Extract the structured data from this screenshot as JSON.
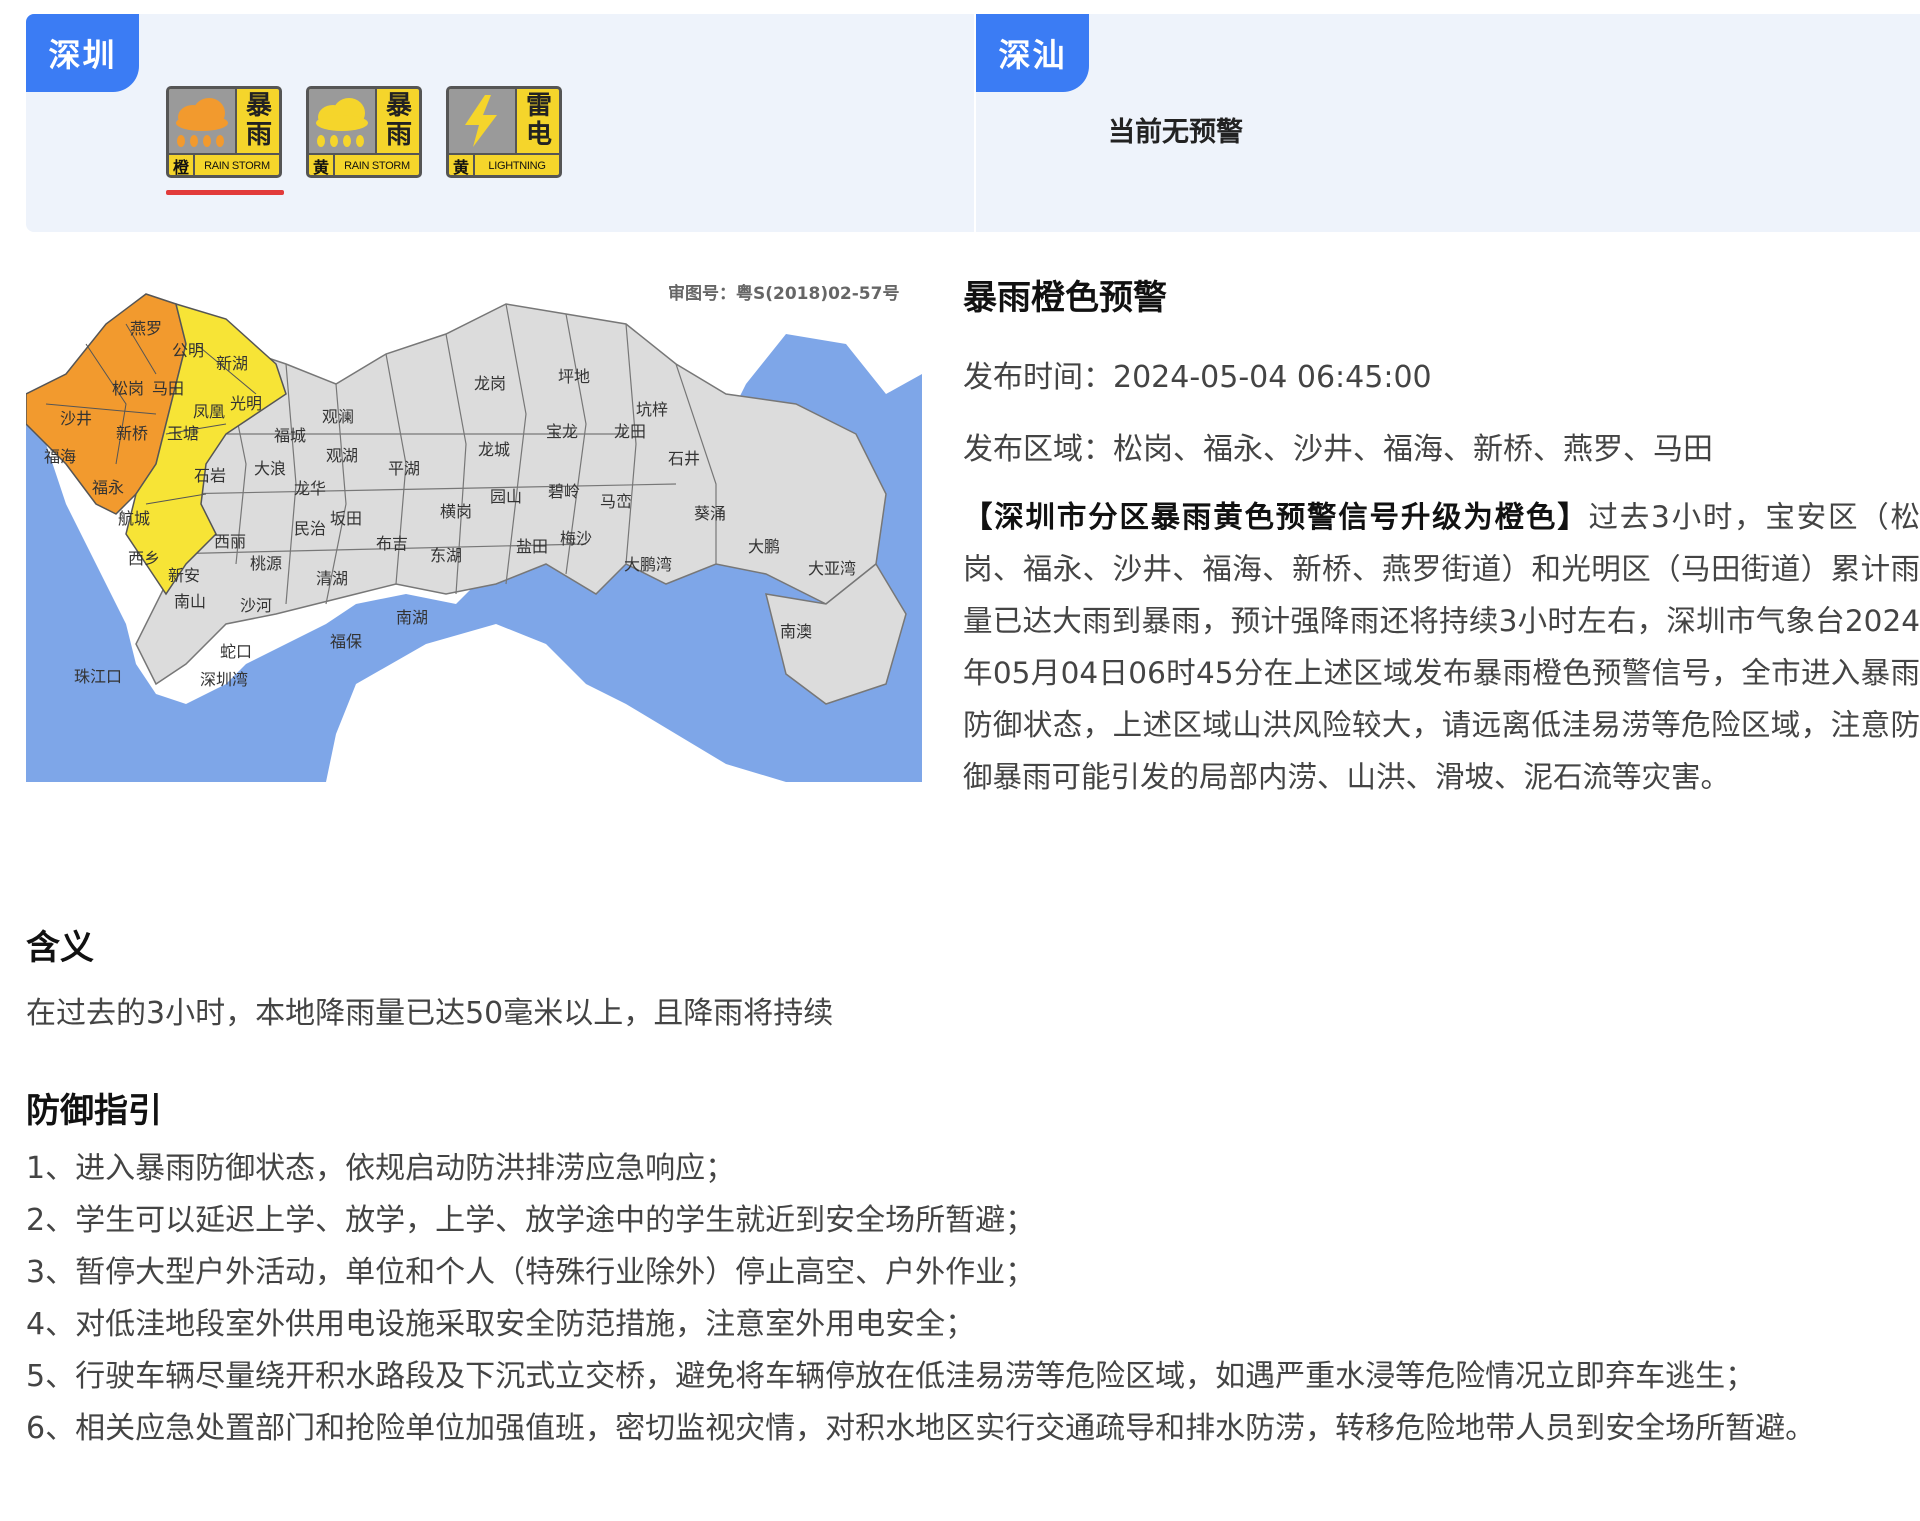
{
  "regions": [
    {
      "name": "深圳"
    },
    {
      "name": "深汕",
      "status_text": "当前无预警"
    }
  ],
  "warnings": [
    {
      "chars": [
        "暴",
        "雨"
      ],
      "level": "橙",
      "en": "RAIN STORM",
      "color": "#f29a2e",
      "icon": "rain-cloud-icon",
      "selected": true
    },
    {
      "chars": [
        "暴",
        "雨"
      ],
      "level": "黄",
      "en": "RAIN STORM",
      "color": "#f5d52b",
      "icon": "rain-cloud-icon",
      "selected": false
    },
    {
      "chars": [
        "雷",
        "电"
      ],
      "level": "黄",
      "en": "LIGHTNING",
      "color": "#f5d52b",
      "icon": "lightning-icon",
      "selected": false
    }
  ],
  "map": {
    "approval_no": "审图号：粤S(2018)02-57号",
    "labels": {
      "yanluo": "燕罗",
      "gongming": "公明",
      "xinhu": "新湖",
      "songgang": "松岗",
      "matian": "马田",
      "shajing": "沙井",
      "fengyuan": "凤凰",
      "guangming": "光明",
      "xinqiao": "新桥",
      "yutang": "玉塘",
      "fuhai": "福海",
      "fuyong": "福永",
      "shiyan": "石岩",
      "hangcheng": "航城",
      "xixiang": "西乡",
      "guanlan": "观澜",
      "guanhu": "观湖",
      "longhua": "龙华",
      "minzhi": "民治",
      "dalang": "大浪",
      "fucheng": "福城",
      "pinghu": "平湖",
      "longgang": "龙岗",
      "pingdi": "坪地",
      "baolong": "宝龙",
      "longcheng": "龙城",
      "yuanshan": "园山",
      "bijling": "碧岭",
      "mawanzhi": "马峦",
      "kengzi": "坑梓",
      "longtian": "龙田",
      "shijing": "石井",
      "kuiyong": "葵涌",
      "dapeng": "大鹏",
      "nanao": "南澳",
      "dapengwan": "大鹏湾",
      "dayawan": "大亚湾",
      "yantian": "盐田",
      "meisha": "梅沙",
      "nanshan": "南山",
      "shekou": "蛇口",
      "zhujiangkou": "珠江口",
      "shenzhenwan": "深圳湾",
      "xinan": "新安",
      "xili": "西丽",
      "taoyuan": "桃源",
      "shahe": "沙河",
      "fubao": "福保",
      "donghu": "东湖",
      "nanhu": "南湖",
      "henggang": "横岗",
      "buji": "布吉",
      "bantian": "坂田",
      "qinghu": "清湖"
    }
  },
  "detail": {
    "title": "暴雨橙色预警",
    "publish_time": "发布时间：2024-05-04 06:45:00",
    "publish_area": "发布区域：松岗、福永、沙井、福海、新桥、燕罗、马田",
    "body_lead": "【深圳市分区暴雨黄色预警信号升级为橙色】",
    "body_text": "过去3小时，宝安区（松岗、福永、沙井、福海、新桥、燕罗街道）和光明区（马田街道）累计雨量已达大雨到暴雨，预计强降雨还将持续3小时左右，深圳市气象台2024年05月04日06时45分在上述区域发布暴雨橙色预警信号，全市进入暴雨防御状态，上述区域山洪风险较大，请远离低洼易涝等危险区域，注意防御暴雨可能引发的局部内涝、山洪、滑坡、泥石流等灾害。"
  },
  "meaning": {
    "title": "含义",
    "text": "在过去的3小时，本地降雨量已达50毫米以上，且降雨将持续"
  },
  "guide": {
    "title": "防御指引",
    "items": [
      "1、进入暴雨防御状态，依规启动防洪排涝应急响应；",
      "2、学生可以延迟上学、放学，上学、放学途中的学生就近到安全场所暂避；",
      "3、暂停大型户外活动，单位和个人（特殊行业除外）停止高空、户外作业；",
      "4、对低洼地段室外供用电设施采取安全防范措施，注意室外用电安全；",
      "5、行驶车辆尽量绕开积水路段及下沉式立交桥，避免将车辆停放在低洼易涝等危险区域，如遇严重水浸等危险情况立即弃车逃生；",
      "6、相关应急处置部门和抢险单位加强值班，密切监视灾情，对积水地区实行交通疏导和排水防涝，转移危险地带人员到安全场所暂避。"
    ]
  }
}
